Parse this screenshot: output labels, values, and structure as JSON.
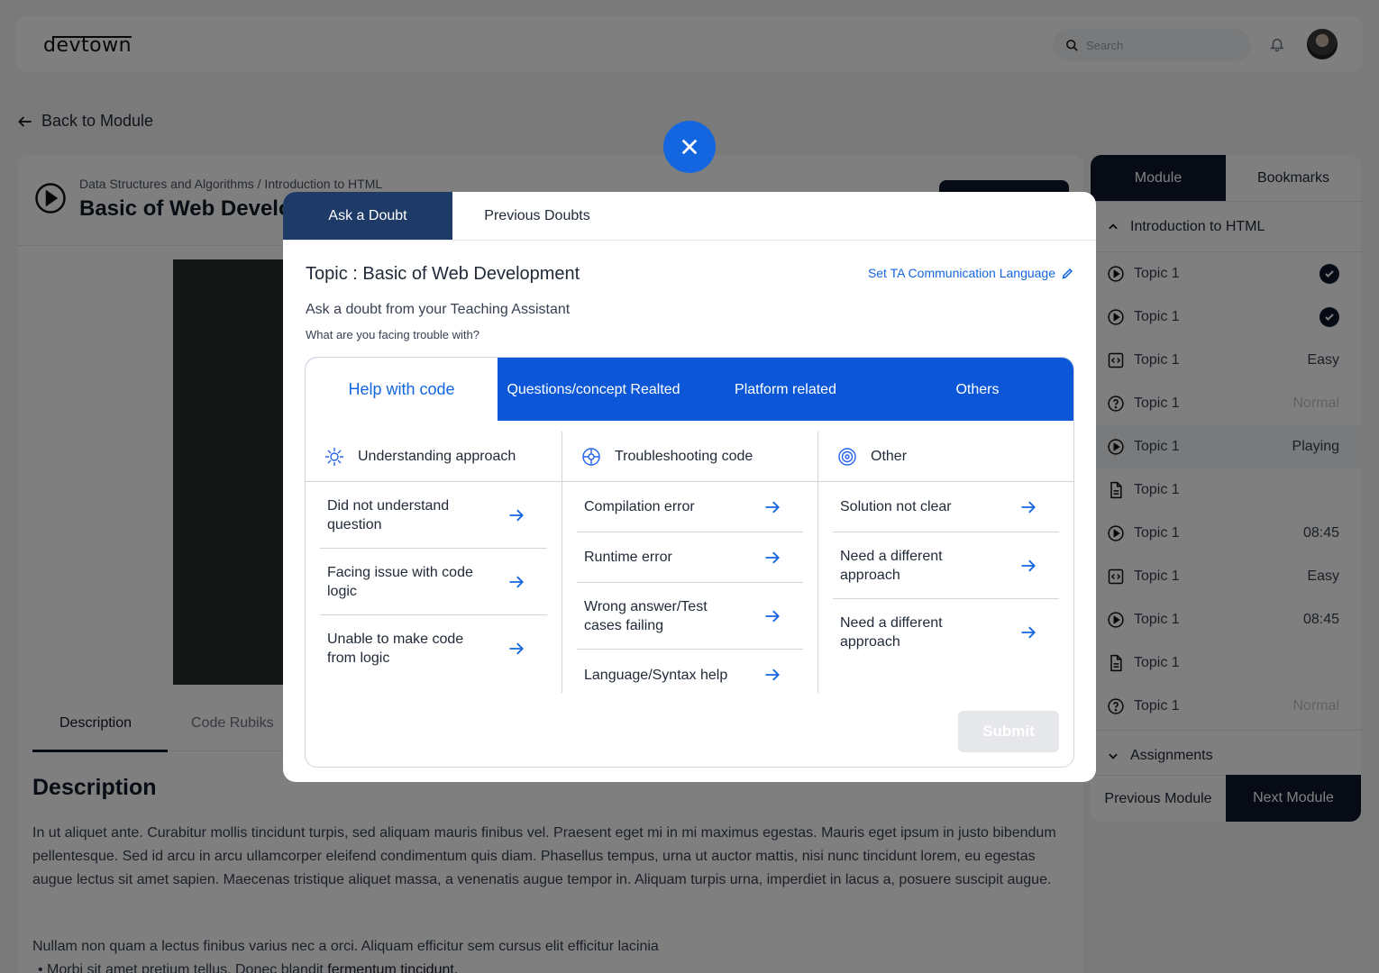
{
  "header": {
    "logo": "devtown",
    "search_placeholder": "Search"
  },
  "back_link": "Back to Module",
  "lesson": {
    "breadcrumb": "Data Structures and Algorithms / Introduction to HTML",
    "title": "Basic of Web Development",
    "tabs": [
      "Description",
      "Code Rubiks"
    ],
    "description_heading": "Description",
    "description_p1": "In ut aliquet ante. Curabitur mollis tincidunt turpis, sed aliquam mauris finibus vel. Praesent eget mi in mi maximus egestas. Mauris eget ipsum in justo bibendum pellentesque. Sed id arcu in arcu ullamcorper eleifend condimentum quis diam. Phasellus tempus, urna ut auctor mattis, nisi nunc tincidunt lorem, eu egestas augue lectus sit amet sapien. Maecenas tristique aliquet massa, a venenatis augue tempor in. Aliquam turpis urna, imperdiet in lacus a, posuere suscipit augue.",
    "description_p2": "Nullam non quam a lectus finibus varius nec a orci. Aliquam efficitur sem cursus elit efficitur lacinia",
    "description_li_text": "Morbi sit amet pretium tellus. Donec blandit ",
    "description_li_link": "fermentum tincidunt."
  },
  "sidebar": {
    "tabs": [
      "Module",
      "Bookmarks"
    ],
    "section": "Introduction to HTML",
    "items": [
      {
        "icon": "play-circle-icon",
        "label": "Topic 1",
        "meta": "",
        "status": "done"
      },
      {
        "icon": "play-circle-icon",
        "label": "Topic 1",
        "meta": "",
        "status": "done"
      },
      {
        "icon": "code-icon",
        "label": "Topic 1",
        "meta": "Easy",
        "status": ""
      },
      {
        "icon": "question-icon",
        "label": "Topic 1",
        "meta": "Normal",
        "status": "muted"
      },
      {
        "icon": "play-circle-icon",
        "label": "Topic 1",
        "meta": "Playing",
        "status": "playing"
      },
      {
        "icon": "document-icon",
        "label": "Topic 1",
        "meta": "",
        "status": ""
      },
      {
        "icon": "play-circle-icon",
        "label": "Topic 1",
        "meta": "08:45",
        "status": ""
      },
      {
        "icon": "code-icon",
        "label": "Topic 1",
        "meta": "Easy",
        "status": ""
      },
      {
        "icon": "play-circle-icon",
        "label": "Topic 1",
        "meta": "08:45",
        "status": ""
      },
      {
        "icon": "document-icon",
        "label": "Topic 1",
        "meta": "",
        "status": ""
      },
      {
        "icon": "question-icon",
        "label": "Topic 1",
        "meta": "Normal",
        "status": "muted"
      }
    ],
    "assignments": "Assignments",
    "prev_module": "Previous Module",
    "next_module": "Next Module"
  },
  "modal": {
    "tabs": [
      "Ask a Doubt",
      "Previous Doubts"
    ],
    "topic": "Topic : Basic of Web Development",
    "set_language": "Set TA Communication Language",
    "subtitle": "Ask a doubt from your Teaching Assistant",
    "question": "What are you facing trouble with?",
    "categories": [
      "Help with code",
      "Questions/concept Realted",
      "Platform related",
      "Others"
    ],
    "columns": [
      {
        "icon": "approach-icon",
        "heading": "Understanding approach",
        "options": [
          "Did not understand question",
          "Facing issue with code logic",
          "Unable to make code from logic"
        ]
      },
      {
        "icon": "bug-target-icon",
        "heading": "Troubleshooting code",
        "options": [
          "Compilation error",
          "Runtime error",
          "Wrong answer/Test cases failing",
          "Language/Syntax help"
        ]
      },
      {
        "icon": "other-target-icon",
        "heading": "Other",
        "options": [
          "Solution not clear",
          "Need a different approach",
          "Need a different approach"
        ]
      }
    ],
    "submit": "Submit"
  },
  "colors": {
    "primary_blue": "#1366e0",
    "tab_blue": "#0b57d8",
    "dark_navy": "#0f172a",
    "active_tab": "#1e3a66"
  }
}
